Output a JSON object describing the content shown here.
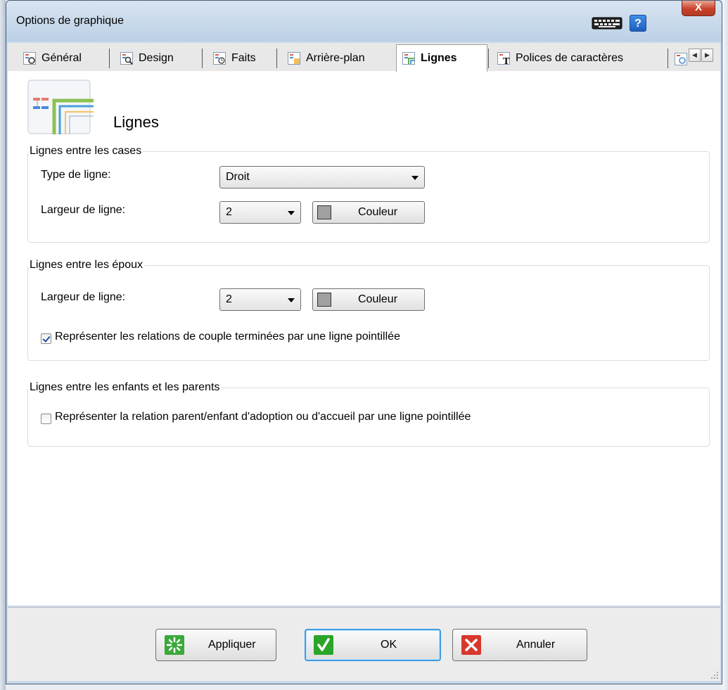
{
  "window": {
    "title": "Options de graphique",
    "close_label": "X",
    "help_label": "?"
  },
  "tabs": [
    {
      "label": "Général",
      "icon": "gear-chart-icon"
    },
    {
      "label": "Design",
      "icon": "magnifier-chart-icon"
    },
    {
      "label": "Faits",
      "icon": "clock-chart-icon"
    },
    {
      "label": "Arrière-plan",
      "icon": "background-chart-icon"
    },
    {
      "label": "Lignes",
      "icon": "lines-chart-icon",
      "active": true
    },
    {
      "label": "Polices de caractères",
      "icon": "font-chart-icon"
    }
  ],
  "page": {
    "title": "Lignes"
  },
  "group_boxes": {
    "label": "Lignes entre les cases",
    "line_type_label": "Type de ligne:",
    "line_type_value": "Droit",
    "line_width_label": "Largeur de ligne:",
    "line_width_value": "2",
    "color_button": "Couleur"
  },
  "group_spouses": {
    "label": "Lignes entre les époux",
    "line_width_label": "Largeur de ligne:",
    "line_width_value": "2",
    "color_button": "Couleur",
    "dotted_checkbox_label": "Représenter les relations de couple terminées par une ligne pointillée",
    "dotted_checked": true
  },
  "group_children": {
    "label": "Lignes entre les enfants et les parents",
    "dotted_checkbox_label": "Représenter la relation parent/enfant d'adoption ou d'accueil par une ligne pointillée",
    "dotted_checked": false
  },
  "footer": {
    "apply": "Appliquer",
    "ok": "OK",
    "cancel": "Annuler"
  },
  "colors": {
    "swatch": "#a0a0a0",
    "ok_green": "#2aa52a",
    "cancel_red": "#d9372b",
    "apply_green": "#3aa83a"
  }
}
